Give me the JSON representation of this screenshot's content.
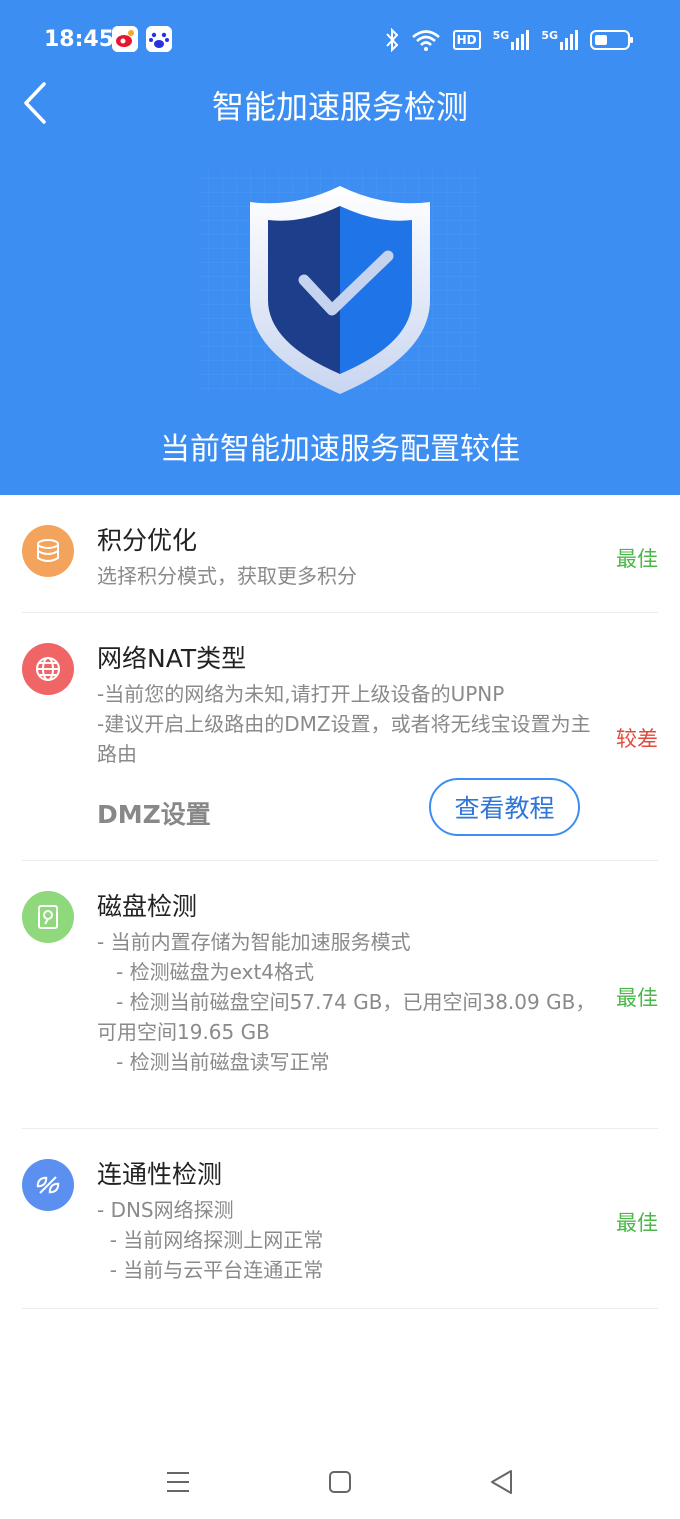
{
  "status_bar": {
    "time": "18:45",
    "icons": [
      "weibo-icon",
      "baidu-icon",
      "bluetooth-icon",
      "wifi-icon",
      "hd-icon",
      "signal-5g-icon",
      "signal-5g-icon",
      "battery-icon"
    ],
    "hd_label": "HD",
    "net1": "5G",
    "net2": "5G"
  },
  "header": {
    "title": "智能加速服务检测",
    "result": "当前智能加速服务配置较佳",
    "background": "#3d8ef3"
  },
  "items": [
    {
      "icon": "database-icon",
      "title": "积分优化",
      "desc": "选择积分模式，获取更多积分",
      "status": "最佳"
    },
    {
      "icon": "globe-icon",
      "title": "网络NAT类型",
      "desc": "-当前您的网络为未知,请打开上级设备的UPNP\n-建议开启上级路由的DMZ设置，或者将无线宝设置为主路由",
      "status": "较差",
      "extra_label": "DMZ设置",
      "button": "查看教程"
    },
    {
      "icon": "disk-icon",
      "title": "磁盘检测",
      "desc": "- 当前内置存储为智能加速服务模式\n   - 检测磁盘为ext4格式\n   - 检测当前磁盘空间57.74 GB，已用空间38.09 GB，可用空间19.65 GB\n   - 检测当前磁盘读写正常",
      "status": "最佳"
    },
    {
      "icon": "link-icon",
      "title": "连通性检测",
      "desc": "- DNS网络探测\n  - 当前网络探测上网正常\n  - 当前与云平台连通正常",
      "status": "最佳"
    }
  ],
  "colors": {
    "good": "#4cb84a",
    "bad": "#e04a3a",
    "accent": "#3d8ef3"
  }
}
